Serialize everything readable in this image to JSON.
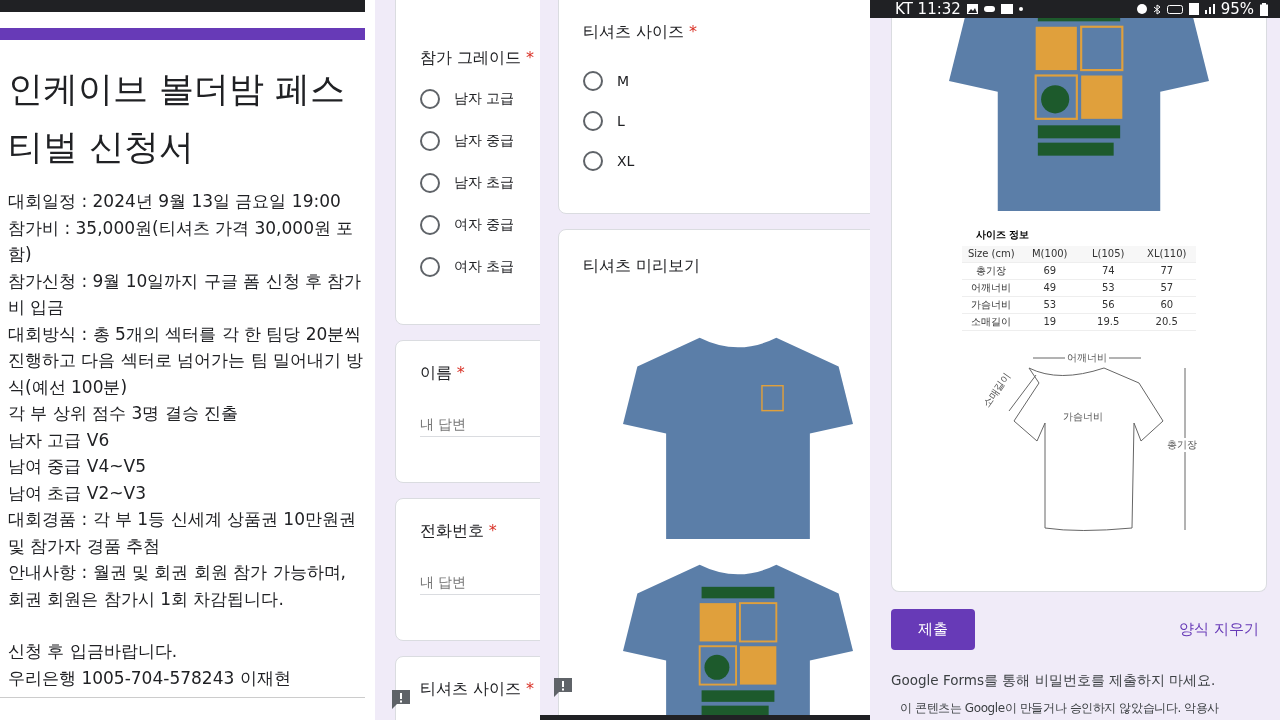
{
  "info_panel": {
    "title": "인케이브 볼더밤 페스티벌 신청서",
    "description": [
      "대회일정 : 2024년 9월 13일 금요일 19:00",
      "참가비 : 35,000원(티셔츠 가격 30,000원 포함)",
      "참가신청 :  9월 10일까지 구글 폼 신청 후 참가비 입금",
      "대회방식 : 총 5개의 섹터를 각 한 팀당 20분씩 진행하고 다음 섹터로 넘어가는 팀 밀어내기 방식(예선 100분)",
      "각 부 상위 점수 3명 결승 진출",
      "남자 고급 V6",
      "남여 중급 V4~V5",
      "남여 초급 V2~V3",
      "대회경품 : 각 부 1등 신세계 상품권 10만원권 및 참가자 경품 추첨",
      "안내사항 : 월권 및 회권 회원 참가 가능하며, 회권 회원은 참가시 1회 차감됩니다."
    ],
    "payment_note": [
      "신청 후 입금바랍니다.",
      "우리은행 1005-704-578243 이재현"
    ]
  },
  "form_column": [
    {
      "kind": "radio",
      "label": "참가 그레이드",
      "required_mark": "*",
      "options": [
        {
          "label": "남자 고급",
          "selected": false
        },
        {
          "label": "남자 중급",
          "selected": false
        },
        {
          "label": "남자 초급",
          "selected": false
        },
        {
          "label": "여자 중급",
          "selected": false
        },
        {
          "label": "여자 초급",
          "selected": false
        }
      ]
    },
    {
      "kind": "text",
      "label": "이름",
      "required_mark": "*",
      "placeholder": "내 답변"
    },
    {
      "kind": "text",
      "label": "전화번호",
      "required_mark": "*",
      "placeholder": "내 답변"
    },
    {
      "kind": "heading",
      "label": "티셔츠 사이즈",
      "required_mark": "*"
    }
  ],
  "size_column": {
    "question": {
      "label": "티셔츠 사이즈",
      "required_mark": "*",
      "options": [
        {
          "label": "M",
          "selected": false
        },
        {
          "label": "L",
          "selected": false
        },
        {
          "label": "XL",
          "selected": false
        }
      ]
    },
    "preview_title": "티셔츠 미리보기"
  },
  "status_bar": {
    "carrier_time": "KT 11:32",
    "battery": "95%"
  },
  "size_chart": {
    "title": "사이즈 정보",
    "columns": [
      "Size (cm)",
      "M(100)",
      "L(105)",
      "XL(110)"
    ],
    "rows": [
      [
        "총기장",
        "69",
        "74",
        "77"
      ],
      [
        "어깨너비",
        "49",
        "53",
        "57"
      ],
      [
        "가슴너비",
        "53",
        "56",
        "60"
      ],
      [
        "소매길이",
        "19",
        "19.5",
        "20.5"
      ]
    ],
    "diagram_labels": {
      "shoulder": "어깨너비",
      "sleeve": "소매길이",
      "chest": "가슴너비",
      "length": "총기장"
    }
  },
  "submit_button": "제출",
  "clear_link": "양식 지우기",
  "footer_notes": [
    "Google Forms를 통해 비밀번호를 제출하지 마세요.",
    "이 콘텐츠는 Google이 만들거나 승인하지 않았습니다. 악용사"
  ]
}
